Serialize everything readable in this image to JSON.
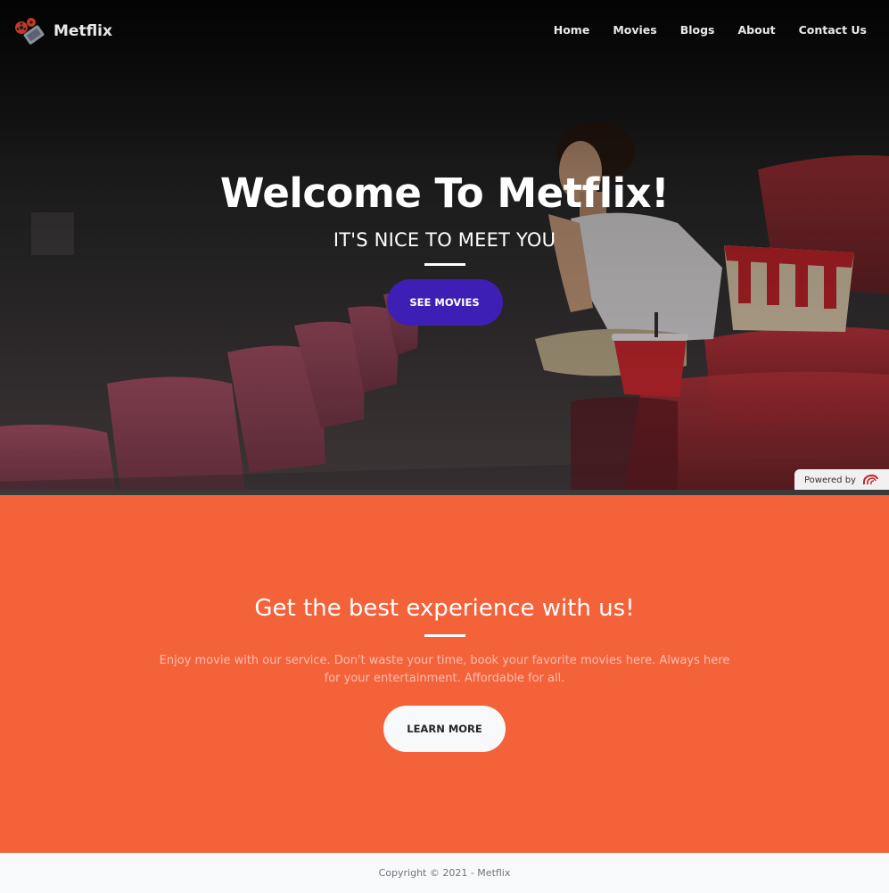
{
  "brand": {
    "name": "Metflix",
    "logo_icon": "film-reel-icon"
  },
  "nav": {
    "items": [
      {
        "label": "Home"
      },
      {
        "label": "Movies"
      },
      {
        "label": "Blogs"
      },
      {
        "label": "About"
      },
      {
        "label": "Contact Us"
      }
    ]
  },
  "hero": {
    "title": "Welcome To Metflix!",
    "subtitle": "IT'S NICE TO MEET YOU",
    "cta_label": "SEE MOVIES",
    "cta_color": "#3e1fb5"
  },
  "powered": {
    "text": "Powered by"
  },
  "about": {
    "title": "Get the best experience with us!",
    "text": "Enjoy movie with our service. Don't waste your time, book your favorite movies here. Always here for your entertainment. Affordable for all.",
    "cta_label": "LEARN MORE",
    "background_color": "#f4623a"
  },
  "footer": {
    "copyright": "Copyright © 2021 - Metflix"
  }
}
